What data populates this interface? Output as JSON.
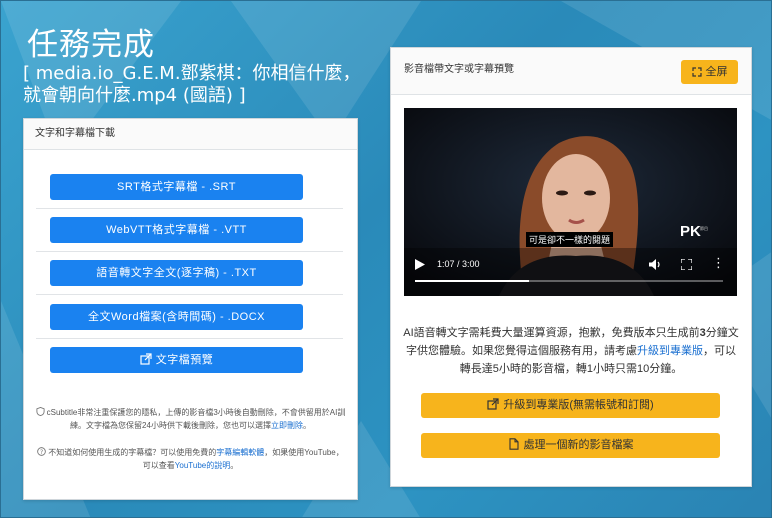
{
  "page": {
    "title": "任務完成",
    "filename": "[ media.io_G.E.M.鄧紫棋：你相信什麼，就會朝向什麼.mp4 (國語) ]"
  },
  "left_card": {
    "header": "文字和字幕檔下載",
    "buttons": [
      "SRT格式字幕檔 - .SRT",
      "WebVTT格式字幕檔 - .VTT",
      "語音轉文字全文(逐字稿) - .TXT",
      "全文Word檔案(含時間碼) - .DOCX",
      "文字檔預覽"
    ],
    "privacy_note": {
      "text1": "cSubtitle非常注重保護您的隱私，上傳的影音檔3小時後自動刪除，不會供留用於AI訓練。文字檔為您保留24小時供下載後刪除，您也可以選擇",
      "link": "立即刪除",
      "text2": "。"
    },
    "help_note": {
      "text1": "不知道如何使用生成的字幕檔？可以使用免費的",
      "link1": "字幕編輯軟體",
      "text2": "，如果使用YouTube，可以查看",
      "link2": "YouTube的說明",
      "text3": "。"
    }
  },
  "right_card": {
    "header": "影音檔帶文字或字幕預覽",
    "fullscreen_label": "全屏",
    "video": {
      "subtitle": "可是卻不一樣的閱題",
      "time": "1:07 / 3:00",
      "progress": 0.37,
      "watermark": "PK"
    },
    "ai_text": {
      "text1": "AI語音轉文字需耗費大量運算資源，抱歉，免費版本只生成前",
      "bold": "3",
      "text2": "分鐘文字供您體驗。如果您覺得這個服務有用，請考慮",
      "link": "升級到專業版",
      "text3": "，可以轉長達5小時的影音檔，轉1小時只需10分鐘。"
    },
    "upgrade_button": "升級到專業版(無需帳號和訂閱)",
    "new_file_button": "處理一個新的影音檔案"
  },
  "colors": {
    "background": "#2e8fbd",
    "primary_button": "#1a82f0",
    "accent_button": "#f7b41c",
    "link": "#1a6fd0"
  }
}
